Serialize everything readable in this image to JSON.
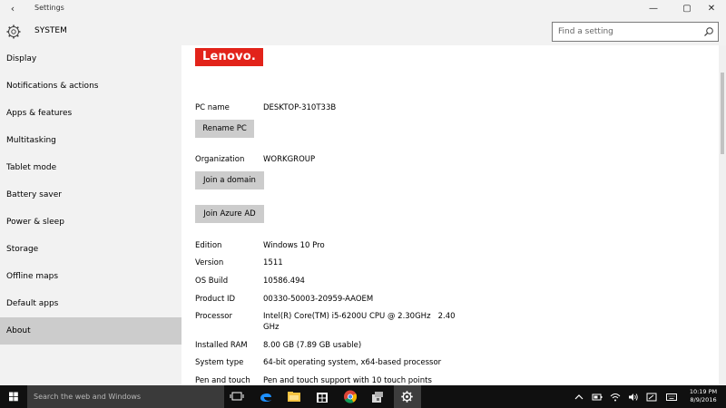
{
  "window": {
    "title": "Settings",
    "back_glyph": "‹",
    "minimize_glyph": "—",
    "maximize_glyph": "▢",
    "close_glyph": "✕"
  },
  "header": {
    "title": "SYSTEM",
    "search_placeholder": "Find a setting"
  },
  "sidebar": {
    "items": [
      {
        "label": "Display"
      },
      {
        "label": "Notifications & actions"
      },
      {
        "label": "Apps & features"
      },
      {
        "label": "Multitasking"
      },
      {
        "label": "Tablet mode"
      },
      {
        "label": "Battery saver"
      },
      {
        "label": "Power & sleep"
      },
      {
        "label": "Storage"
      },
      {
        "label": "Offline maps"
      },
      {
        "label": "Default apps"
      },
      {
        "label": "About"
      }
    ],
    "active": "About"
  },
  "content": {
    "logo_text": "Lenovo.",
    "pc_name_label": "PC name",
    "pc_name_value": "DESKTOP-310T33B",
    "rename_button": "Rename PC",
    "organization_label": "Organization",
    "organization_value": "WORKGROUP",
    "join_domain_button": "Join a domain",
    "join_azure_button": "Join Azure AD",
    "specs": [
      {
        "label": "Edition",
        "value": "Windows 10 Pro"
      },
      {
        "label": "Version",
        "value": "1511"
      },
      {
        "label": "OS Build",
        "value": "10586.494"
      },
      {
        "label": "Product ID",
        "value": "00330-50003-20959-AAOEM"
      },
      {
        "label": "Processor",
        "value": "Intel(R) Core(TM) i5-6200U CPU @ 2.30GHz   2.40",
        "value_line2": "GHz"
      },
      {
        "label": "Installed RAM",
        "value": "8.00 GB (7.89 GB usable)"
      },
      {
        "label": "System type",
        "value": "64-bit operating system, x64-based processor"
      },
      {
        "label": "Pen and touch",
        "value": "Pen and touch support with 10 touch points"
      }
    ]
  },
  "taskbar": {
    "search_text": "Search the web and Windows",
    "clock_time": "10:19 PM",
    "clock_date": "8/9/2016"
  },
  "colors": {
    "chrome_bg": "#f2f2f2",
    "active_nav": "#cccccc",
    "lenovo_red": "#e2231a",
    "taskbar_bg": "#101010",
    "edge_blue": "#1e90ff"
  }
}
